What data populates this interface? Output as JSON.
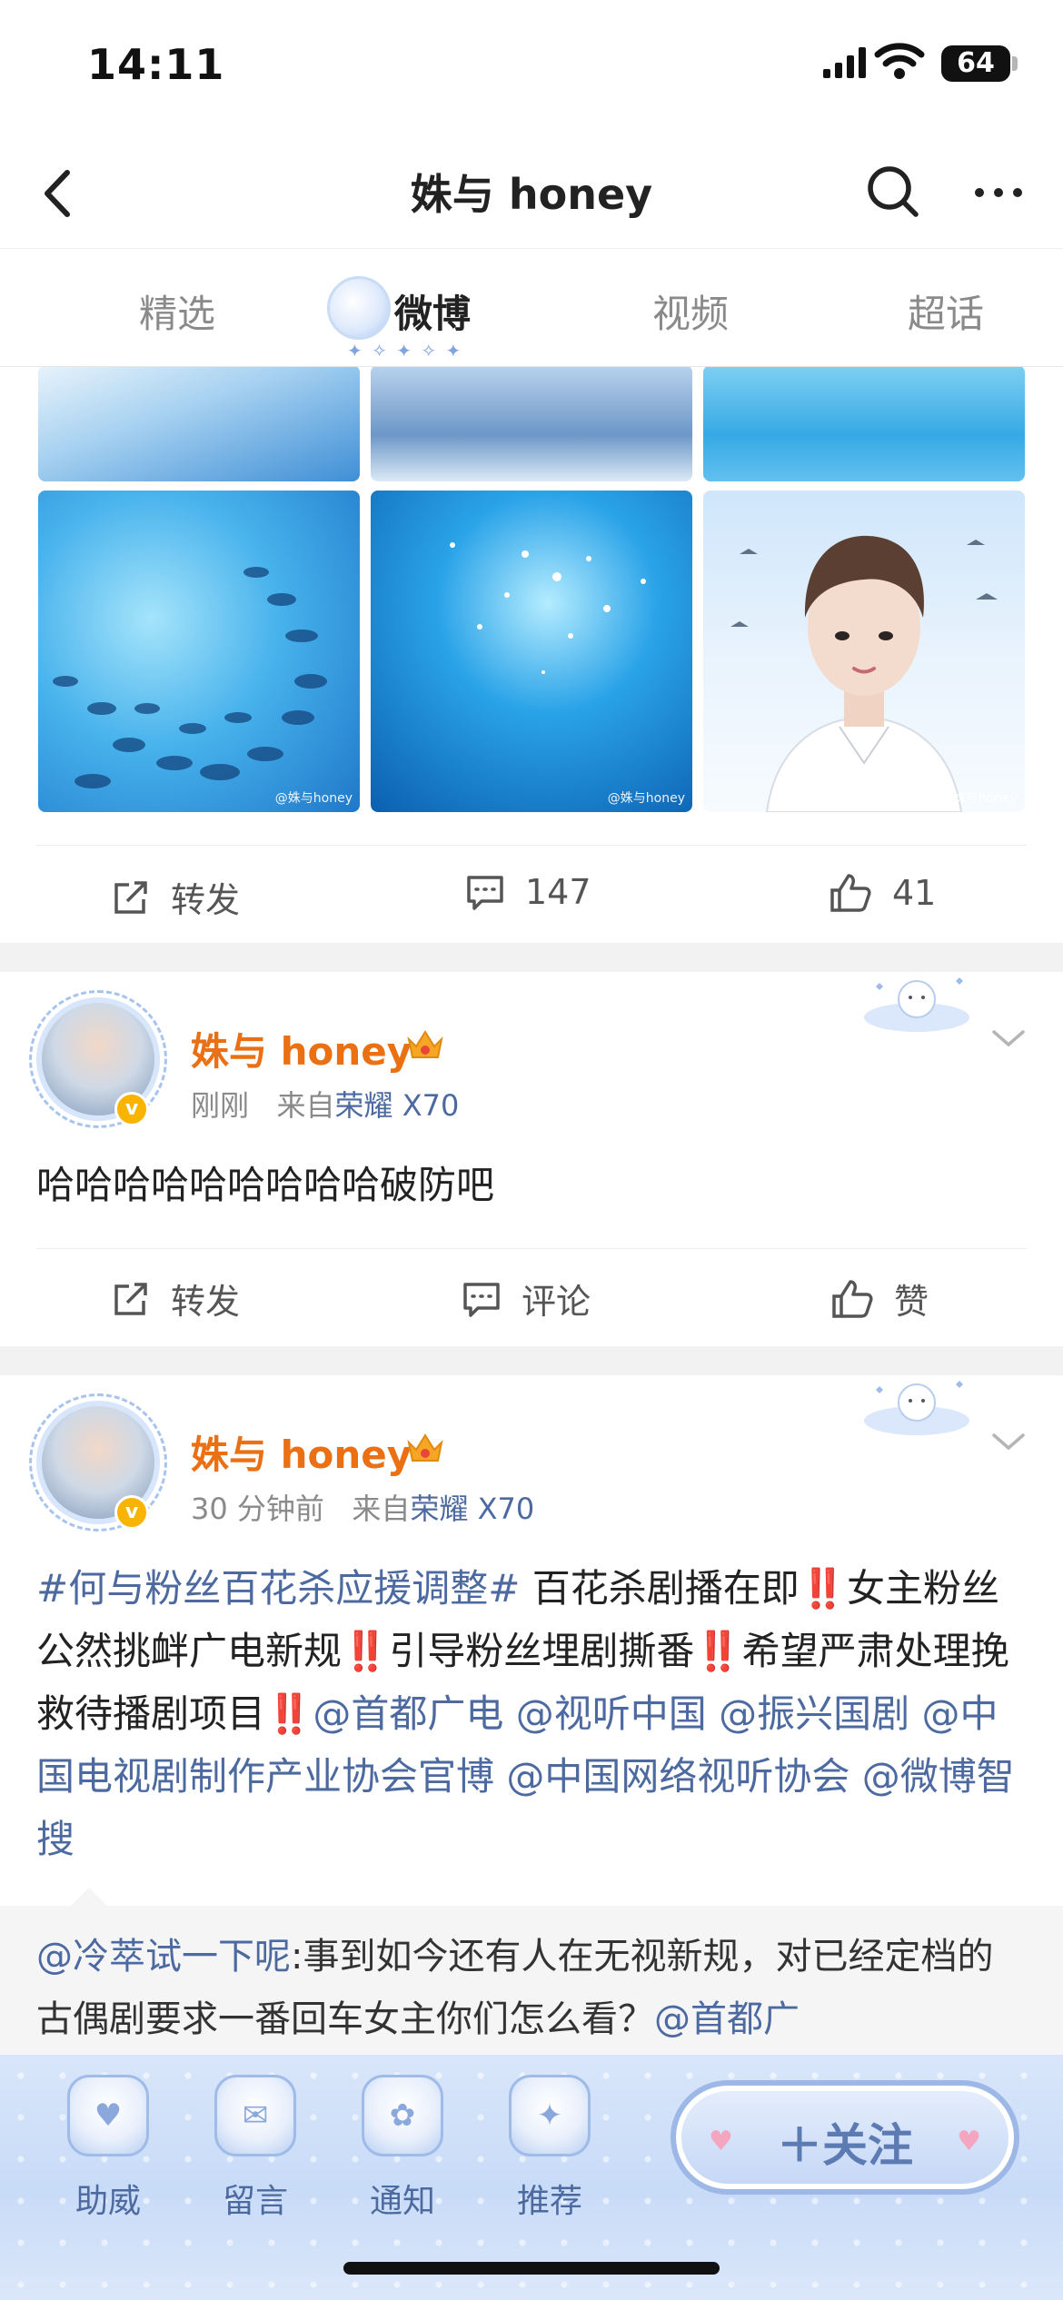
{
  "status_bar": {
    "time": "14:11",
    "battery": "64"
  },
  "nav": {
    "title": "姝与 honey"
  },
  "tabs": [
    {
      "label": "精选",
      "active": false
    },
    {
      "label": "微博",
      "active": true
    },
    {
      "label": "视频",
      "active": false
    },
    {
      "label": "超话",
      "active": false
    }
  ],
  "first_post_actions": {
    "repost": "转发",
    "comments": "147",
    "likes": "41"
  },
  "post1": {
    "username": "姝与 honey",
    "time": "刚刚",
    "from": "来自",
    "device": "荣耀 X70",
    "text": "哈哈哈哈哈哈哈哈哈破防吧",
    "actions": {
      "repost": "转发",
      "comment": "评论",
      "like": "赞"
    }
  },
  "post2": {
    "username": "姝与 honey",
    "time": "30 分钟前",
    "from": "来自",
    "device": "荣耀 X70",
    "hashtag": "#何与粉丝百花杀应援调整#",
    "seg1": " 百花杀剧播在即",
    "seg2": "女主粉丝公然挑衅广电新规",
    "seg3": "引导粉丝埋剧撕番",
    "seg4": "希望严肃处理挽救待播剧项目",
    "bang": "‼️",
    "mentions": [
      "@首都广电",
      "@视听中国",
      "@振兴国剧",
      "@中国电视剧制作产业协会官博",
      "@中国网络视听协会",
      "@微博智搜"
    ],
    "repost_user": "@冷萃试一下呢",
    "repost_text": ":事到如今还有人在无视新规，对已经定档的古偶剧要求一番回车女主你们怎么看？",
    "repost_mention": "@首都广"
  },
  "bottom_bar": {
    "items": [
      "助威",
      "留言",
      "通知",
      "推荐"
    ],
    "follow_label": "＋关注"
  },
  "colors": {
    "accent": "#eb7014",
    "link": "#4d6aa0",
    "alert": "#e0202e"
  }
}
